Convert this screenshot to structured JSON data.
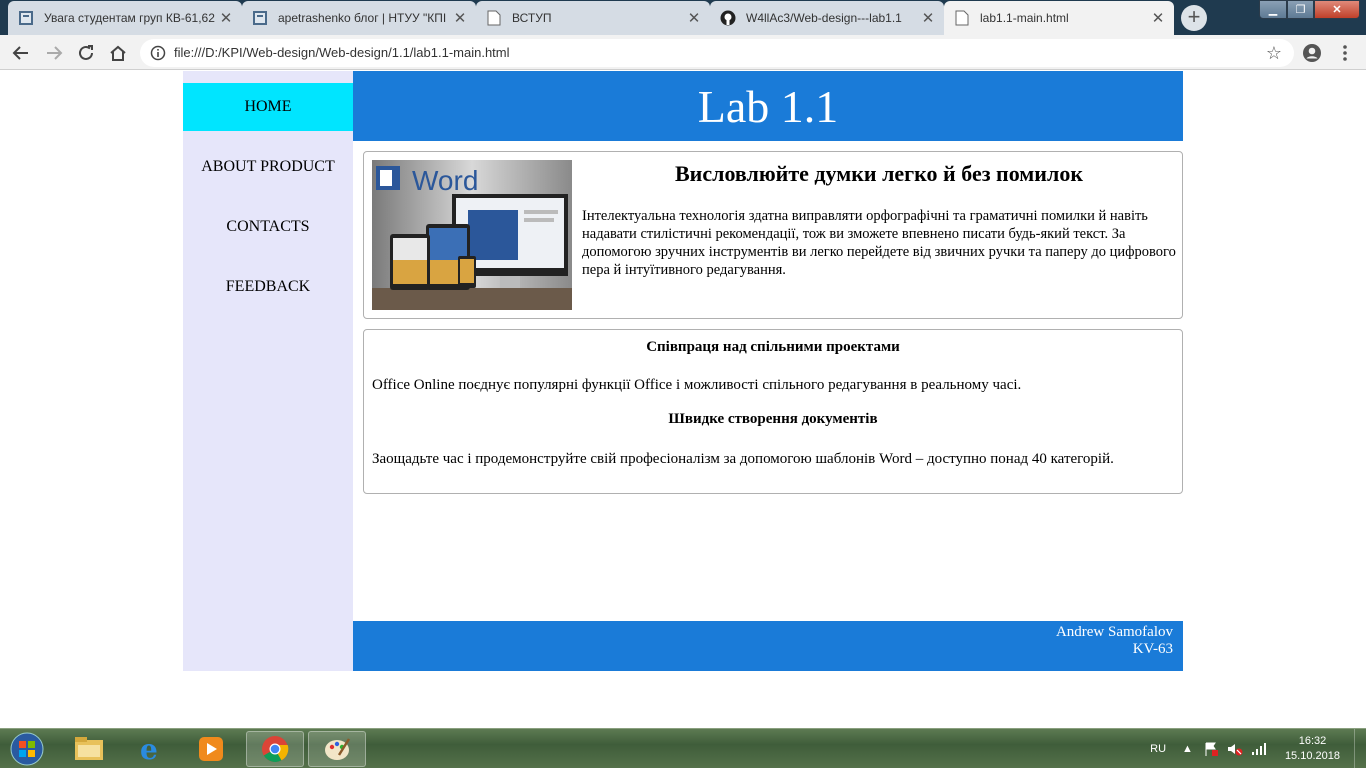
{
  "browser": {
    "tabs": [
      {
        "title": "Увага студентам груп КВ-61,62",
        "icon": "document-icon",
        "active": false
      },
      {
        "title": "apetrashenko блог | НТУУ \"КПІ",
        "icon": "document-icon",
        "active": false
      },
      {
        "title": "ВСТУП",
        "icon": "page-icon",
        "active": false
      },
      {
        "title": "W4llAc3/Web-design---lab1.1",
        "icon": "github-icon",
        "active": false
      },
      {
        "title": "lab1.1-main.html",
        "icon": "page-icon",
        "active": true
      }
    ],
    "url": "file:///D:/KPI/Web-design/Web-design/1.1/lab1.1-main.html"
  },
  "page": {
    "header_title": "Lab 1.1",
    "nav": [
      {
        "label": "HOME",
        "active": true
      },
      {
        "label": "ABOUT PRODUCT",
        "active": false
      },
      {
        "label": "CONTACTS",
        "active": false
      },
      {
        "label": "FEEDBACK",
        "active": false
      }
    ],
    "card1": {
      "image_label": "Word",
      "heading": "Висловлюйте думки легко й без помилок",
      "text": "Інтелектуальна технологія здатна виправляти орфографічні та граматичні помилки й навіть надавати стилістичні рекомендації, тож ви зможете впевнено писати будь-який текст. За допомогою зручних інструментів ви легко перейдете від звичних ручки та паперу до цифрового пера й інтуїтивного редагування."
    },
    "card2": {
      "heading1": "Співпраця над спільними проектами",
      "text1": "Office Online поєднує популярні функції Office і можливості спільного редагування в реальному часі.",
      "heading2": "Швидке створення документів",
      "text2": "Заощадьте час і продемонструйте свій професіоналізм за допомогою шаблонів Word – доступно понад 40 категорій."
    },
    "footer": {
      "name": "Andrew Samofalov",
      "group": "KV-63"
    },
    "colors": {
      "accent": "#1a7bd8",
      "nav_active": "#00e5ff",
      "sidebar": "#e6e6fa"
    }
  },
  "taskbar": {
    "language": "RU",
    "time": "16:32",
    "date": "15.10.2018"
  }
}
